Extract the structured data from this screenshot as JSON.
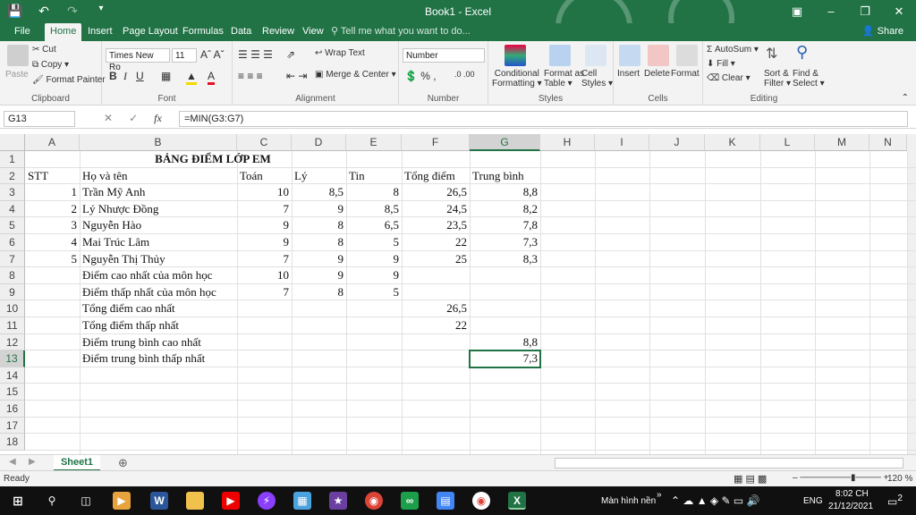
{
  "window": {
    "title": "Book1 - Excel",
    "minimize_icon": "minimize-icon",
    "restore_icon": "restore-icon",
    "close_icon": "close-icon",
    "ribbon_display_icon": "ribbon-display-icon"
  },
  "qat": [
    "save-icon",
    "undo-icon",
    "redo-icon",
    "customize-qat-icon"
  ],
  "tabs": [
    "File",
    "Home",
    "Insert",
    "Page Layout",
    "Formulas",
    "Data",
    "Review",
    "View"
  ],
  "active_tab": "Home",
  "tell_me": "Tell me what you want to do...",
  "share": "Share",
  "ribbon": {
    "clipboard": {
      "paste": "Paste",
      "cut": "Cut",
      "copy": "Copy",
      "format_painter": "Format Painter",
      "label": "Clipboard"
    },
    "font": {
      "name": "Times New Ro",
      "size": "11",
      "label": "Font"
    },
    "alignment": {
      "wrap_text": "Wrap Text",
      "merge_center": "Merge & Center",
      "label": "Alignment"
    },
    "number": {
      "format": "Number",
      "label": "Number"
    },
    "styles": {
      "conditional": "Conditional",
      "formatting": "Formatting",
      "format_as": "Format as",
      "table": "Table",
      "cell": "Cell",
      "styles": "Styles",
      "label": "Styles"
    },
    "cells": {
      "insert": "Insert",
      "delete": "Delete",
      "format": "Format",
      "label": "Cells"
    },
    "editing": {
      "autosum": "AutoSum",
      "fill": "Fill",
      "clear": "Clear",
      "sort_filter": "Sort &",
      "filter": "Filter",
      "find_select": "Find &",
      "select": "Select",
      "label": "Editing"
    }
  },
  "formula_bar": {
    "name_box": "G13",
    "formula": "=MIN(G3:G7)"
  },
  "columns": [
    "A",
    "B",
    "C",
    "D",
    "E",
    "F",
    "G",
    "H",
    "I",
    "J",
    "K",
    "L",
    "M",
    "N"
  ],
  "rows": [
    "1",
    "2",
    "3",
    "4",
    "5",
    "6",
    "7",
    "8",
    "9",
    "10",
    "11",
    "12",
    "13",
    "14",
    "15",
    "16",
    "17",
    "18"
  ],
  "sheet": {
    "title": "BẢNG ĐIỂM LỚP EM",
    "headers": [
      "STT",
      "Họ và tên",
      "Toán",
      "Lý",
      "Tin",
      "Tổng điểm",
      "Trung bình"
    ],
    "students": [
      [
        "1",
        "Trần Mỹ Anh",
        "10",
        "8,5",
        "8",
        "26,5",
        "8,8"
      ],
      [
        "2",
        "Lý Nhược Đồng",
        "7",
        "9",
        "8,5",
        "24,5",
        "8,2"
      ],
      [
        "3",
        "Nguyễn Hào",
        "9",
        "8",
        "6,5",
        "23,5",
        "7,8"
      ],
      [
        "4",
        "Mai Trúc Lâm",
        "9",
        "8",
        "5",
        "22",
        "7,3"
      ],
      [
        "5",
        "Nguyễn Thị Thủy",
        "7",
        "9",
        "9",
        "25",
        "8,3"
      ]
    ],
    "max_row": [
      "Điểm cao nhất của môn học",
      "10",
      "9",
      "9"
    ],
    "min_row": [
      "Điểm thấp nhất của môn học",
      "7",
      "8",
      "5"
    ],
    "total_max": [
      "Tổng điểm cao nhất",
      "26,5"
    ],
    "total_min": [
      "Tổng điểm thấp nhất",
      "22"
    ],
    "avg_max": [
      "Điểm trung bình cao nhất",
      "8,8"
    ],
    "avg_min": [
      "Điểm trung bình thấp nhất",
      "7,3"
    ]
  },
  "sheet_tab": "Sheet1",
  "status": {
    "ready": "Ready",
    "zoom": "120 %"
  },
  "taskbar": {
    "tray_label": "Màn hình nền",
    "lang": "ENG",
    "time": "8:02 CH",
    "date": "21/12/2021",
    "notifications": "2"
  },
  "colors": {
    "excel_green": "#217346",
    "taskbar": "#101010"
  }
}
